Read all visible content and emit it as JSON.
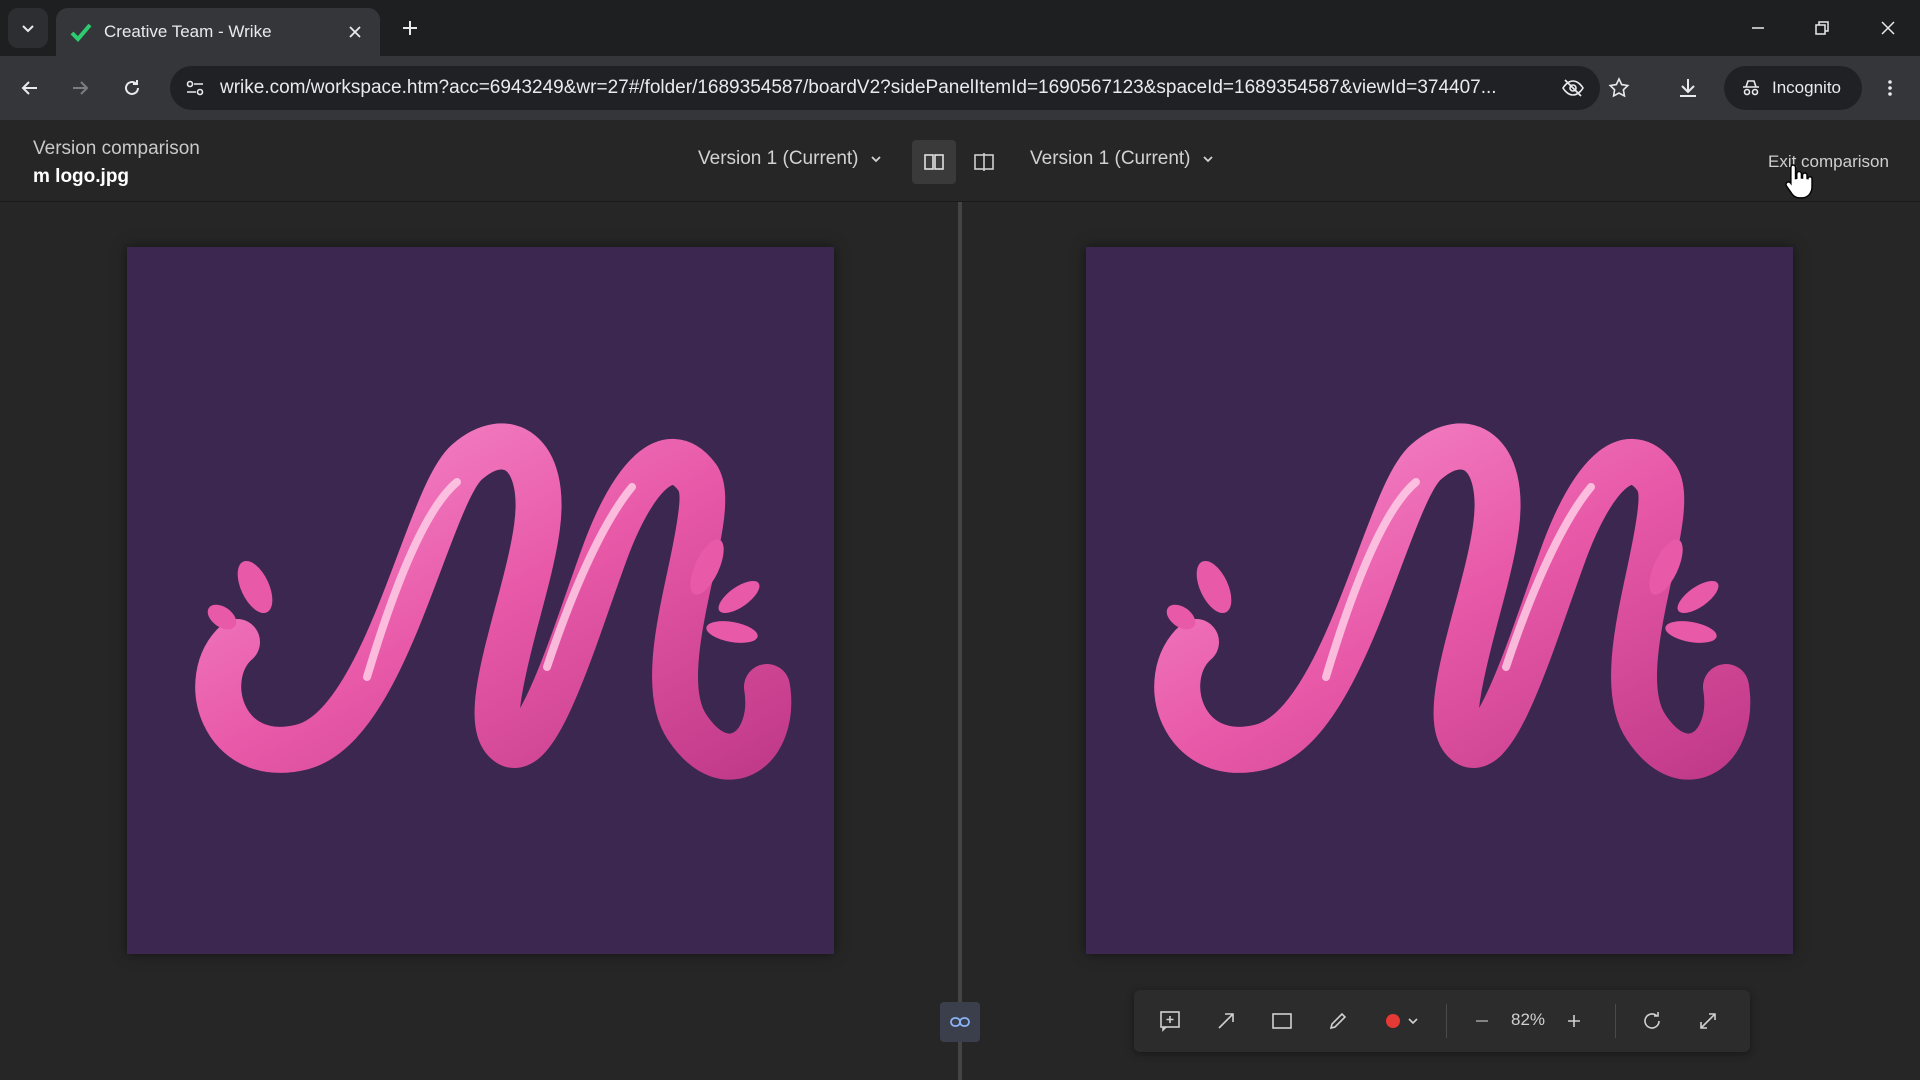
{
  "browser": {
    "tab_title": "Creative Team - Wrike",
    "url": "wrike.com/workspace.htm?acc=6943249&wr=27#/folder/1689354587/boardV2?sidePanelItemId=1690567123&spaceId=1689354587&viewId=374407...",
    "incognito_label": "Incognito"
  },
  "header": {
    "label": "Version comparison",
    "filename": "m logo.jpg",
    "left_version": "Version 1 (Current)",
    "right_version": "Version 1 (Current)",
    "exit_label": "Exit comparison"
  },
  "colors": {
    "image_bg": "#3b2750",
    "logo_pink": "#e859a8",
    "record_red": "#e53935"
  },
  "toolbar": {
    "zoom": "82%"
  }
}
